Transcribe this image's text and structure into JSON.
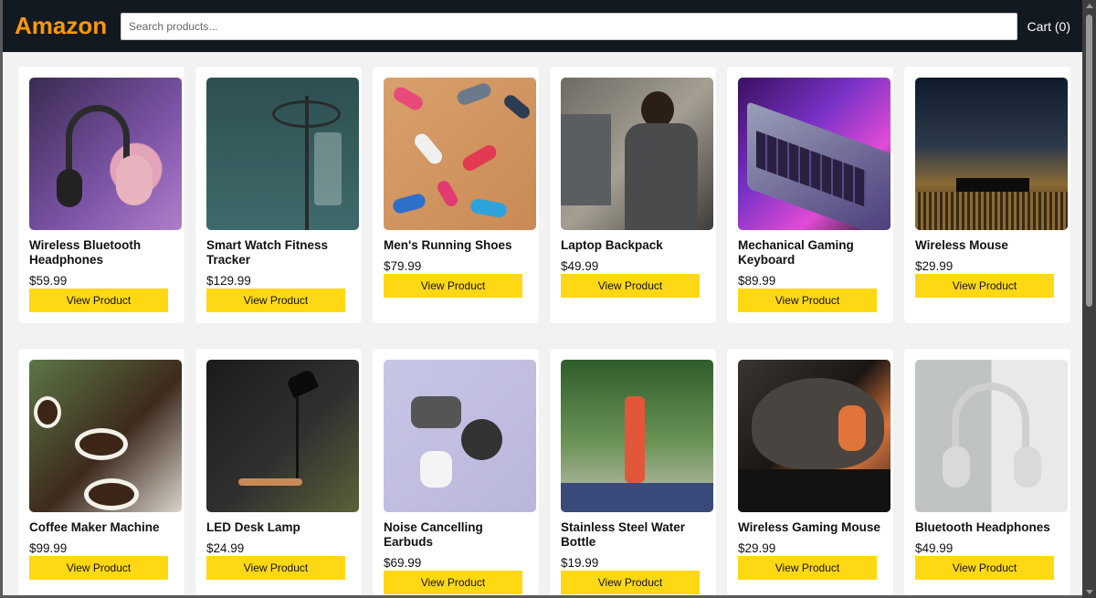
{
  "header": {
    "logo": "Amazon",
    "search_placeholder": "Search products...",
    "cart_label": "Cart (0)"
  },
  "colors": {
    "header_bg": "#131921",
    "logo": "#ff9900",
    "button": "#ffd814"
  },
  "products": [
    {
      "title": "Wireless Bluetooth Headphones",
      "price": "$59.99",
      "button": "View Product",
      "image": "headphones-purple-image"
    },
    {
      "title": "Smart Watch Fitness Tracker",
      "price": "$129.99",
      "button": "View Product",
      "image": "iv-stand-image"
    },
    {
      "title": "Men's Running Shoes",
      "price": "$79.99",
      "button": "View Product",
      "image": "shoes-flatlay-image"
    },
    {
      "title": "Laptop Backpack",
      "price": "$49.99",
      "button": "View Product",
      "image": "man-at-desk-image"
    },
    {
      "title": "Mechanical Gaming Keyboard",
      "price": "$89.99",
      "button": "View Product",
      "image": "laptop-keyboard-image"
    },
    {
      "title": "Wireless Mouse",
      "price": "$29.99",
      "button": "View Product",
      "image": "auditorium-image"
    },
    {
      "title": "Coffee Maker Machine",
      "price": "$99.99",
      "button": "View Product",
      "image": "coffee-cups-image"
    },
    {
      "title": "LED Desk Lamp",
      "price": "$24.99",
      "button": "View Product",
      "image": "desk-lamp-image"
    },
    {
      "title": "Noise Cancelling Earbuds",
      "price": "$69.99",
      "button": "View Product",
      "image": "earbuds-image"
    },
    {
      "title": "Stainless Steel Water Bottle",
      "price": "$19.99",
      "button": "View Product",
      "image": "water-bottle-image"
    },
    {
      "title": "Wireless Gaming Mouse",
      "price": "$29.99",
      "button": "View Product",
      "image": "gaming-mouse-image"
    },
    {
      "title": "Bluetooth Headphones",
      "price": "$49.99",
      "button": "View Product",
      "image": "headphones-white-image"
    }
  ]
}
